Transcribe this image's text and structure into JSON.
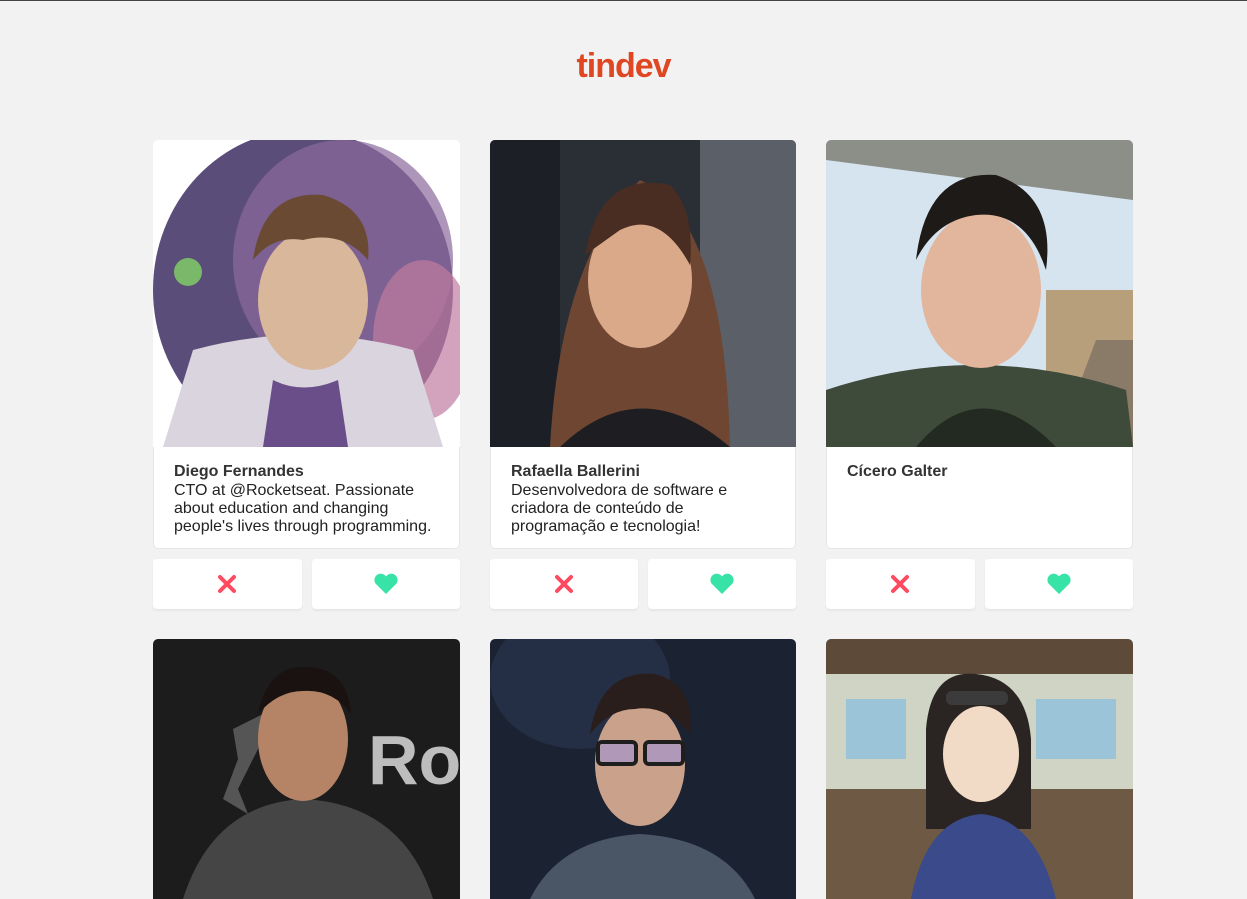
{
  "app": {
    "logo_text": "tindev"
  },
  "colors": {
    "accent": "#df4723",
    "dislike": "#ff4b60",
    "like": "#37e3a6"
  },
  "icons": {
    "dislike": "x-icon",
    "like": "heart-icon"
  },
  "devs": [
    {
      "name": "Diego Fernandes",
      "bio": "CTO at @Rocketseat. Passionate about education and changing people's lives through programming."
    },
    {
      "name": "Rafaella Ballerini",
      "bio": "Desenvolvedora de software e criadora de conteúdo de programação e tecnologia!"
    },
    {
      "name": "Cícero Galter",
      "bio": ""
    }
  ]
}
